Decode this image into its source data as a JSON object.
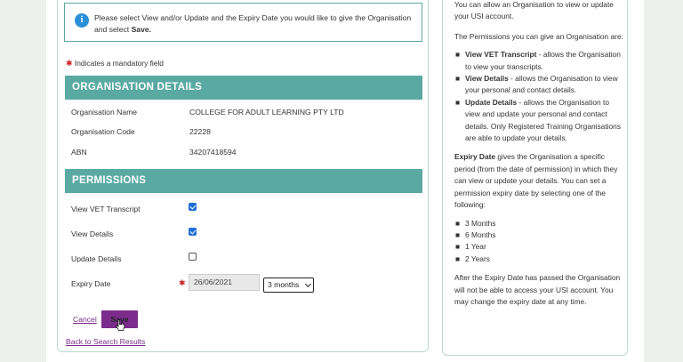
{
  "info": {
    "text_before": "Please select View and/or Update and the Expiry Date you would like to give the Organisation and select ",
    "save_word": "Save."
  },
  "mandatory_note": "Indicates a mandatory field",
  "org_section": {
    "header": "ORGANISATION DETAILS",
    "rows": [
      {
        "label": "Organisation Name",
        "value": "COLLEGE FOR ADULT LEARNING PTY LTD"
      },
      {
        "label": "Organisation Code",
        "value": "22228"
      },
      {
        "label": "ABN",
        "value": "34207418594"
      }
    ]
  },
  "permissions_section": {
    "header": "PERMISSIONS",
    "view_vet": {
      "label": "View VET Transcript",
      "checked": true
    },
    "view_details": {
      "label": "View Details",
      "checked": true
    },
    "update_details": {
      "label": "Update Details",
      "checked": false
    },
    "expiry": {
      "label": "Expiry Date",
      "date_value": "26/06/2021",
      "selected_option": "3 months"
    }
  },
  "actions": {
    "cancel": "Cancel",
    "save": "Save",
    "back": "Back to Search Results"
  },
  "side": {
    "intro": "You can allow an Organisation to view or update your USI account.",
    "permissions_intro": "The Permissions you can give an Organisation are:",
    "permissions": [
      {
        "term": "View VET Transcript",
        "desc": " - allows the Organisation to view your transcripts."
      },
      {
        "term": "View Details",
        "desc": " - allows the Organisation to view your personal and contact details."
      },
      {
        "term": "Update Details",
        "desc": " - allows the Organisation to view and update your personal and contact details. Only Registered Training Organisations are able to update your details."
      }
    ],
    "expiry_term": "Expiry Date",
    "expiry_desc": " gives the Organisation a specific period (from the date of permission) in which they can view or update your details. You can set a permission expiry date by selecting one of the following:",
    "expiry_options": [
      "3 Months",
      "6 Months",
      "1 Year",
      "2 Years"
    ],
    "after_note": "After the Expiry Date has passed the Organisation will not be able to access your USI account. You may change the expiry date at any time."
  },
  "colors": {
    "teal_header": "#5aa9a3",
    "info_icon": "#2a8fd8",
    "link_purple": "#7b2b8c",
    "checkbox_blue": "#1f6fd6",
    "mandatory_red": "#cc2222"
  }
}
